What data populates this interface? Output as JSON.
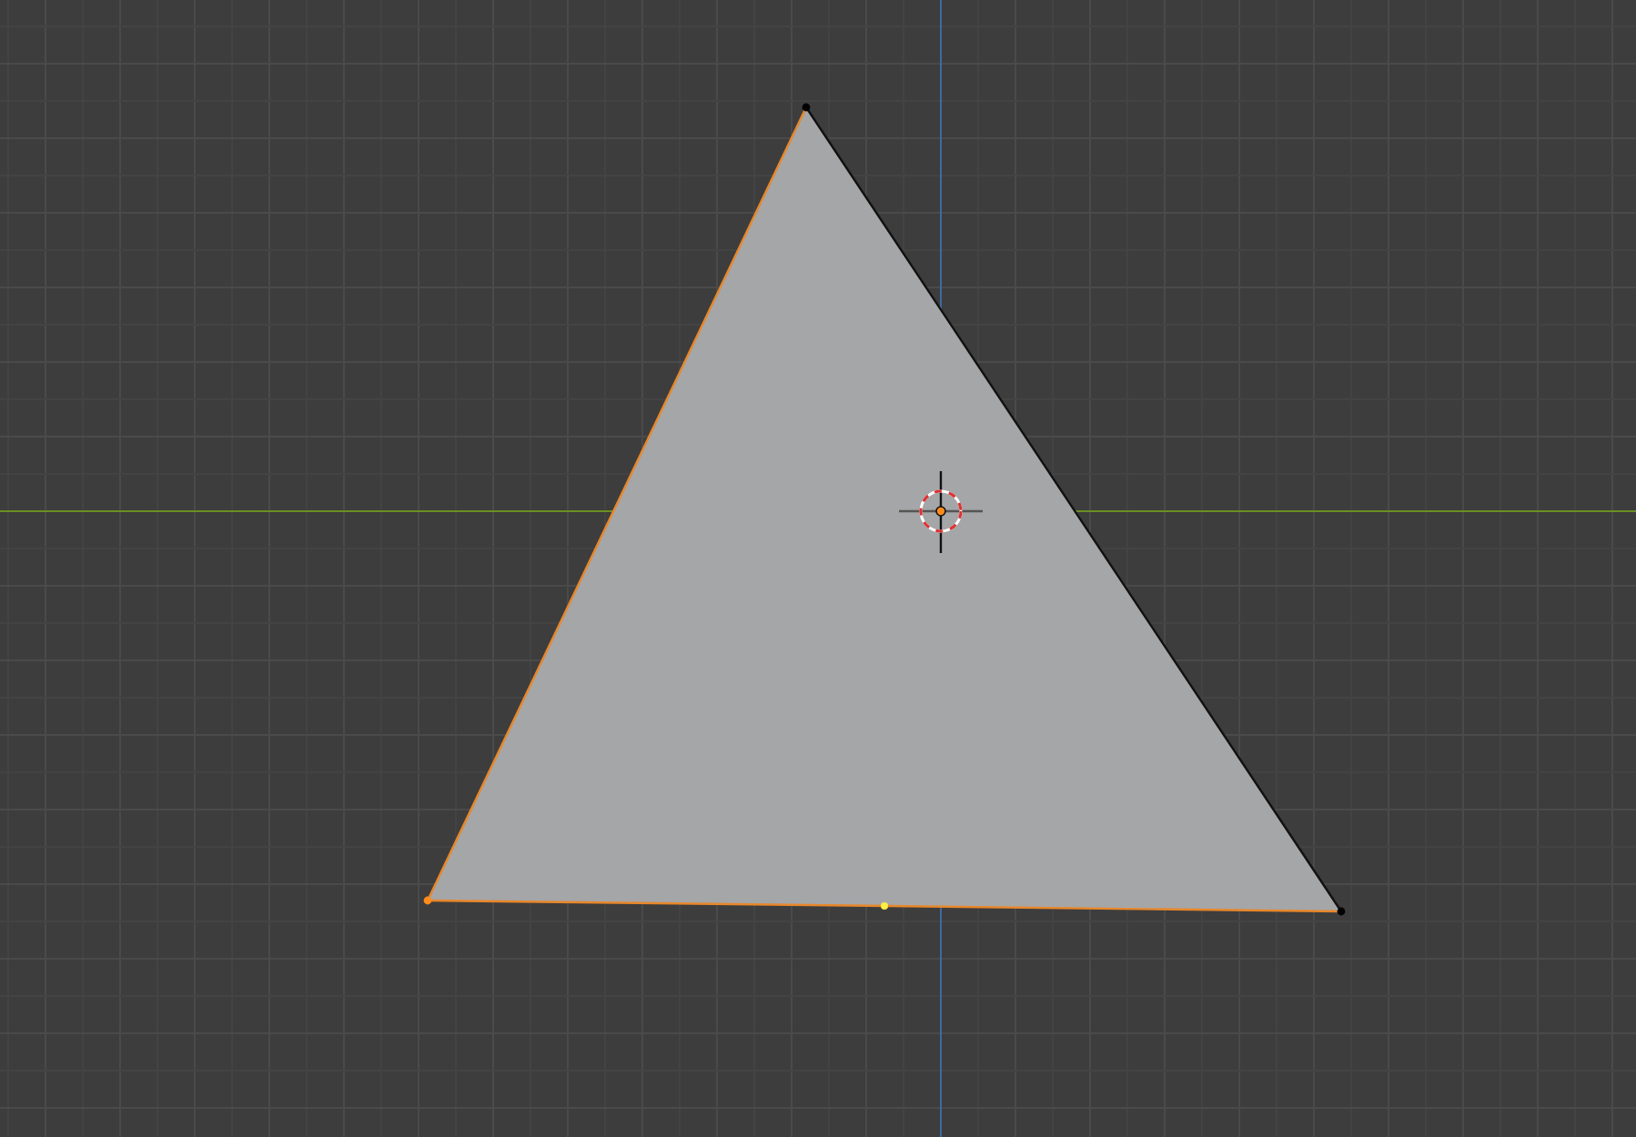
{
  "viewport": {
    "mesh": {
      "vertices": [
        {
          "selected": false
        },
        {
          "selected": true
        },
        {
          "selected": false
        }
      ],
      "edges": [
        {
          "selected": true
        },
        {
          "selected": true
        },
        {
          "selected": false
        }
      ]
    }
  }
}
